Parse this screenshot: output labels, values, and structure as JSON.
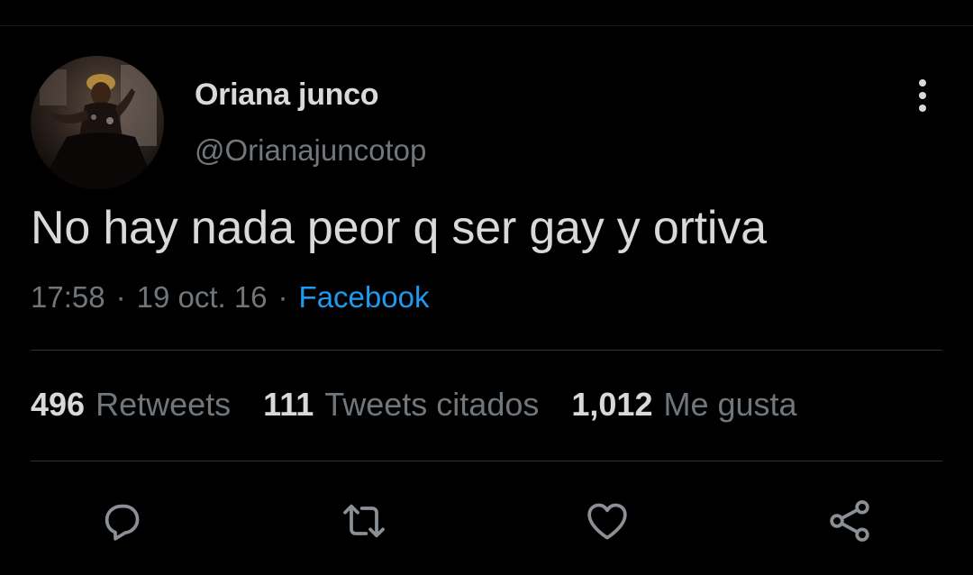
{
  "user": {
    "display_name": "Oriana junco",
    "handle": "@Orianajuncotop"
  },
  "tweet": {
    "text": "No hay nada peor q ser gay y ortiva",
    "time": "17:58",
    "date": "19 oct. 16",
    "separator": "·",
    "source": "Facebook"
  },
  "stats": {
    "retweets_count": "496",
    "retweets_label": "Retweets",
    "quotes_count": "111",
    "quotes_label": "Tweets citados",
    "likes_count": "1,012",
    "likes_label": "Me gusta"
  },
  "icons": {
    "more": "more-vertical-icon",
    "reply": "reply-icon",
    "retweet": "retweet-icon",
    "like": "heart-icon",
    "share": "share-icon"
  },
  "colors": {
    "background": "#000000",
    "text_primary": "#d9d9d9",
    "text_secondary": "#71767b",
    "link": "#1d9bf0",
    "divider": "#2f3336"
  }
}
